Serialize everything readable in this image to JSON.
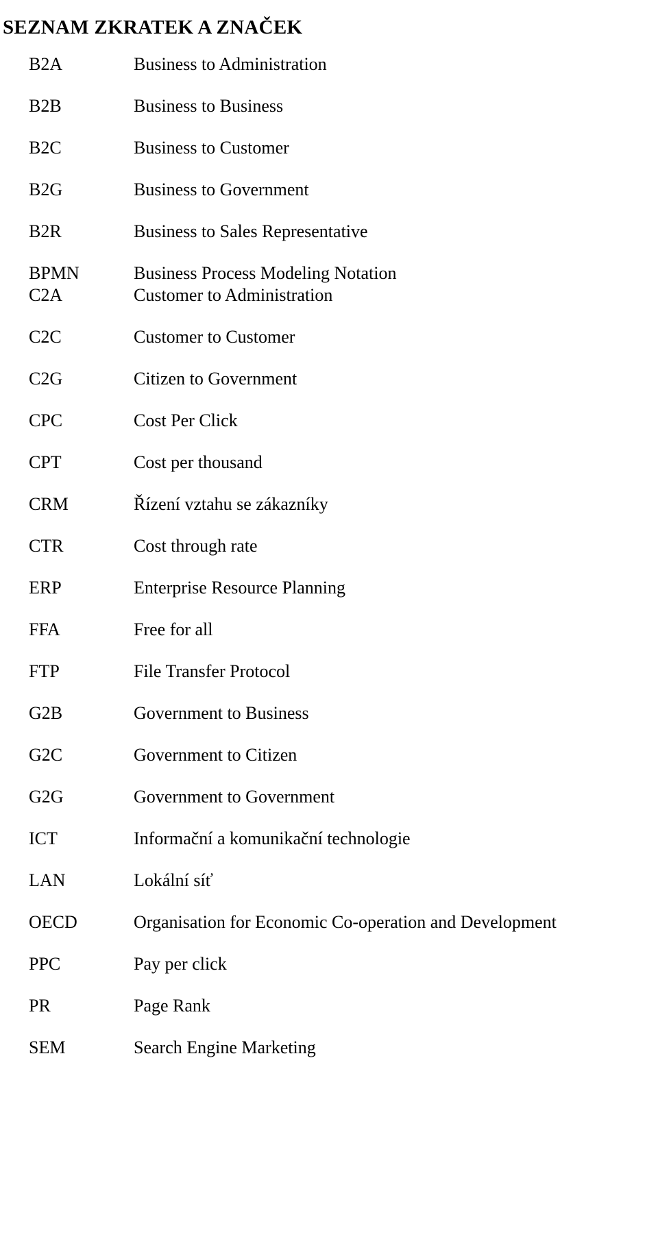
{
  "document": {
    "title": "SEZNAM ZKRATEK A ZNAČEK",
    "page_background": "#ffffff",
    "text_color": "#000000"
  },
  "abbreviations": [
    {
      "term": "B2A",
      "definition": "Business to Administration",
      "tight": false
    },
    {
      "term": "B2B",
      "definition": "Business to Business",
      "tight": false
    },
    {
      "term": "B2C",
      "definition": "Business to Customer",
      "tight": false
    },
    {
      "term": "B2G",
      "definition": "Business to Government",
      "tight": false
    },
    {
      "term": "B2R",
      "definition": "Business to Sales Representative",
      "tight": false
    },
    {
      "term": "BPMN",
      "definition": "Business Process Modeling Notation",
      "tight": true
    },
    {
      "term": "C2A",
      "definition": "Customer to Administration",
      "tight": false
    },
    {
      "term": "C2C",
      "definition": "Customer to Customer",
      "tight": false
    },
    {
      "term": "C2G",
      "definition": "Citizen to Government",
      "tight": false
    },
    {
      "term": "CPC",
      "definition": "Cost Per Click",
      "tight": false
    },
    {
      "term": "CPT",
      "definition": "Cost per thousand",
      "tight": false
    },
    {
      "term": "CRM",
      "definition": "Řízení vztahu se zákazníky",
      "tight": false
    },
    {
      "term": "CTR",
      "definition": "Cost through rate",
      "tight": false
    },
    {
      "term": "ERP",
      "definition": "Enterprise Resource Planning",
      "tight": false
    },
    {
      "term": "FFA",
      "definition": "Free for all",
      "tight": false
    },
    {
      "term": "FTP",
      "definition": "File Transfer Protocol",
      "tight": false
    },
    {
      "term": "G2B",
      "definition": "Government to Business",
      "tight": false
    },
    {
      "term": "G2C",
      "definition": "Government to Citizen",
      "tight": false
    },
    {
      "term": "G2G",
      "definition": "Government to Government",
      "tight": false
    },
    {
      "term": "ICT",
      "definition": "Informační a komunikační technologie",
      "tight": false
    },
    {
      "term": "LAN",
      "definition": "Lokální síť",
      "tight": false
    },
    {
      "term": "OECD",
      "definition": "Organisation for Economic Co-operation and Development",
      "tight": false
    },
    {
      "term": "PPC",
      "definition": "Pay per click",
      "tight": false
    },
    {
      "term": "PR",
      "definition": "Page Rank",
      "tight": false
    },
    {
      "term": "SEM",
      "definition": "Search Engine Marketing",
      "tight": false
    }
  ]
}
